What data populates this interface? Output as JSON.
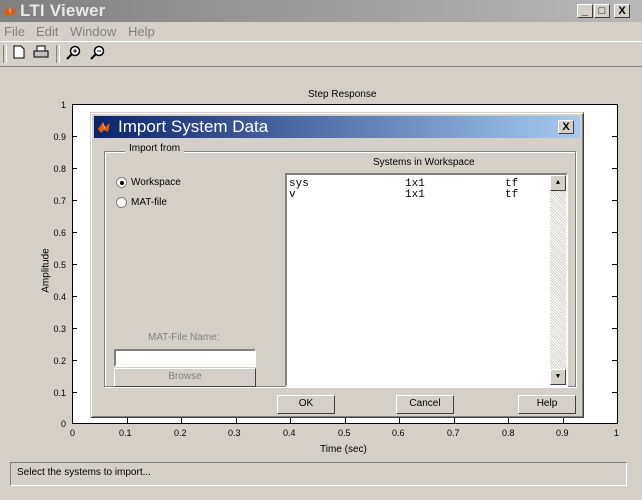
{
  "window": {
    "title": "LTI Viewer",
    "controls": [
      "_",
      "□",
      "X"
    ]
  },
  "menu": [
    "File",
    "Edit",
    "Window",
    "Help"
  ],
  "toolbar": {
    "icons": [
      "new-document-icon",
      "print-icon",
      "zoom-in-icon",
      "zoom-out-icon"
    ]
  },
  "plot": {
    "title": "Step Response",
    "xlabel": "Time (sec)",
    "ylabel": "Amplitude",
    "yticks": [
      "0",
      "0.1",
      "0.2",
      "0.3",
      "0.4",
      "0.5",
      "0.6",
      "0.7",
      "0.8",
      "0.9",
      "1"
    ],
    "xticks": [
      "0",
      "0.1",
      "0.2",
      "0.3",
      "0.4",
      "0.5",
      "0.6",
      "0.7",
      "0.8",
      "0.9",
      "1"
    ]
  },
  "dialog": {
    "title": "Import System Data",
    "close": "X",
    "import_from_label": "Import from",
    "options": [
      "Workspace",
      "MAT-file"
    ],
    "selected_option": "Workspace",
    "systems_header": "Systems in Workspace",
    "systems": [
      {
        "name": "sys",
        "size": "1x1",
        "type": "tf"
      },
      {
        "name": "v",
        "size": "1x1",
        "type": "tf"
      }
    ],
    "matfile_label": "MAT-File Name:",
    "matfile_value": "",
    "browse_label": "Browse",
    "ok_label": "OK",
    "cancel_label": "Cancel",
    "help_label": "Help"
  },
  "status": "Select the systems to import..."
}
